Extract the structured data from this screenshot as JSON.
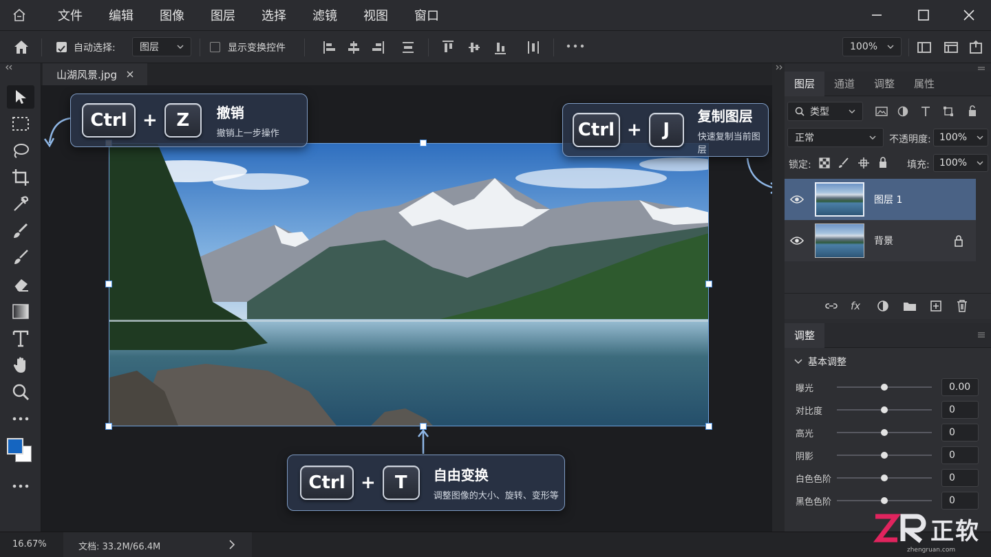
{
  "menu": [
    "文件",
    "编辑",
    "图像",
    "图层",
    "选择",
    "滤镜",
    "视图",
    "窗口"
  ],
  "options": {
    "auto_select_label": "自动选择:",
    "auto_select_value": "图层",
    "show_transform_label": "显示变换控件",
    "zoom_value": "100%"
  },
  "document": {
    "tab_title": "山湖风景.jpg"
  },
  "callouts": {
    "undo": {
      "key1": "Ctrl",
      "plus": "+",
      "key2": "Z",
      "title": "撤销",
      "desc": "撤销上一步操作"
    },
    "duplicate": {
      "key1": "Ctrl",
      "plus": "+",
      "key2": "J",
      "title": "复制图层",
      "desc": "快速复制当前图层"
    },
    "transform": {
      "key1": "Ctrl",
      "plus": "+",
      "key2": "T",
      "title": "自由变换",
      "desc": "调整图像的大小、旋转、变形等"
    }
  },
  "layers_panel": {
    "tabs": [
      "图层",
      "通道",
      "调整",
      "属性"
    ],
    "filter_kind": "类型",
    "blend_mode": "正常",
    "opacity_label": "不透明度:",
    "opacity_value": "100%",
    "lock_label": "锁定:",
    "fill_label": "填充:",
    "fill_value": "100%",
    "layers": [
      {
        "name": "图层 1",
        "selected": true,
        "locked": false
      },
      {
        "name": "背景",
        "selected": false,
        "locked": true
      }
    ]
  },
  "adjust_panel": {
    "title": "调整",
    "section": "基本调整",
    "rows": [
      {
        "label": "曝光",
        "value": "0.00",
        "level": 0.5
      },
      {
        "label": "对比度",
        "value": "0",
        "level": 0.5
      },
      {
        "label": "高光",
        "value": "0",
        "level": 0.5
      },
      {
        "label": "阴影",
        "value": "0",
        "level": 0.5
      },
      {
        "label": "白色色阶",
        "value": "0",
        "level": 0.5
      },
      {
        "label": "黑色色阶",
        "value": "0",
        "level": 0.5
      }
    ]
  },
  "status": {
    "zoom": "16.67%",
    "doc_info": "文档: 33.2M/66.4M"
  },
  "watermark": {
    "text": "正软",
    "sub": "zhengruan.com"
  },
  "colors": {
    "foreground": "#1565c0",
    "background": "#ffffff",
    "accent": "#4a90e2",
    "selected_layer": "#4a6285"
  }
}
